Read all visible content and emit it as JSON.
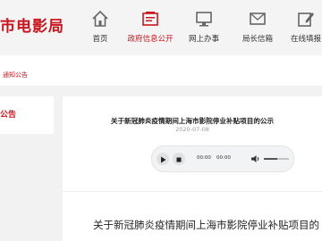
{
  "header": {
    "site_title": "市电影局",
    "nav": [
      {
        "label": "首页",
        "icon": "home-icon"
      },
      {
        "label": "政府信息公开",
        "icon": "folder-icon"
      },
      {
        "label": "网上办事",
        "icon": "monitor-icon"
      },
      {
        "label": "局长信箱",
        "icon": "mail-icon"
      },
      {
        "label": "在线填报",
        "icon": "edit-icon"
      }
    ]
  },
  "breadcrumb": {
    "text": "通知公告"
  },
  "sidebar": {
    "label": "公告"
  },
  "article": {
    "title": "关于新冠肺炎疫情期间上海市影院停业补贴项目的公示",
    "date": "2020-07-08",
    "body_title": "关于新冠肺炎疫情期间上海市影院停业补贴项目的"
  },
  "player": {
    "current_time": "00:00",
    "duration": "00:00",
    "volume_level": 0.55
  },
  "colors": {
    "accent": "#c8161e",
    "topbar": "#f4f4f4",
    "content_bg": "#f2f2f2"
  }
}
